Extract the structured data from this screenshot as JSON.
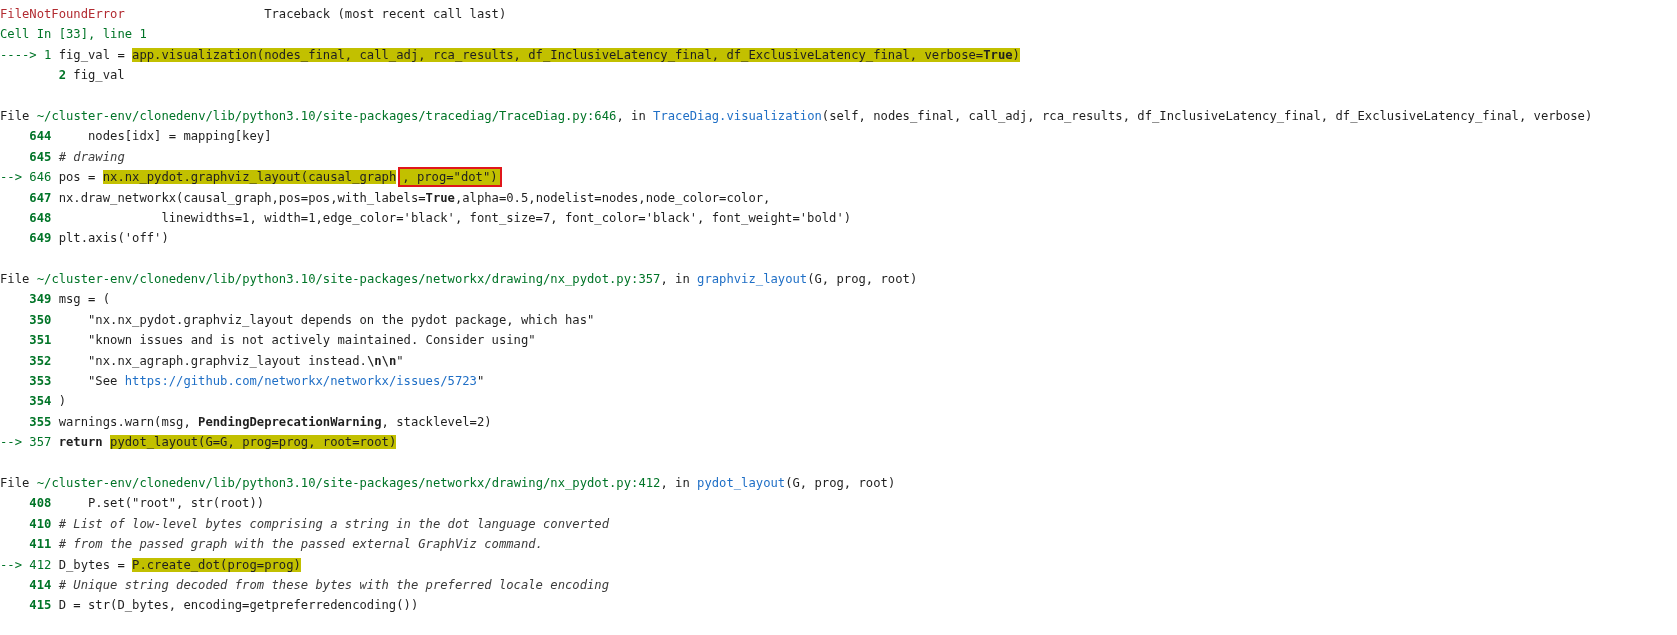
{
  "error": {
    "name": "FileNotFoundError",
    "title": "Traceback (most recent call last)"
  },
  "frames": [
    {
      "kind": "cell",
      "location": "Cell In [33], line 1",
      "marker": "---->",
      "lines": [
        {
          "number": "1",
          "current": true,
          "parts": [
            {
              "kind": "code",
              "text": "fig_val = "
            },
            {
              "kind": "highlight",
              "text": "app.visualization(nodes_final, call_adj, rca_results, df_InclusiveLatency_final, df_ExclusiveLatency_final, verbose=**True**)"
            }
          ]
        },
        {
          "number": "2",
          "current": false,
          "parts": [
            {
              "kind": "code",
              "text": "fig_val"
            }
          ]
        }
      ]
    },
    {
      "kind": "file",
      "file_label": "File",
      "in_label": ", in",
      "location": "~/cluster-env/clonedenv/lib/python3.10/site-packages/tracediag/TraceDiag.py:646",
      "function": "TraceDiag.visualization",
      "signature": "(self, nodes_final, call_adj, rca_results, df_InclusiveLatency_final, df_ExclusiveLatency_final, verbose)",
      "marker": "-->",
      "lines": [
        {
          "number": "644",
          "current": false,
          "parts": [
            {
              "kind": "code",
              "text": "    nodes[idx] = mapping[key]"
            }
          ]
        },
        {
          "number": "645",
          "current": false,
          "parts": [
            {
              "kind": "comment",
              "text": "# drawing"
            }
          ]
        },
        {
          "number": "646",
          "current": true,
          "parts": [
            {
              "kind": "code",
              "text": "pos = "
            },
            {
              "kind": "highlight",
              "text": "nx.nx_pydot.graphviz_layout(causal_graph"
            },
            {
              "kind": "highlight",
              "boxed": true,
              "text": ", prog=\"dot\")"
            }
          ]
        },
        {
          "number": "647",
          "current": false,
          "parts": [
            {
              "kind": "code",
              "text": "nx.draw_networkx(causal_graph,pos=pos,with_labels=**True**,alpha=0.5,nodelist=nodes,node_color=color,"
            }
          ]
        },
        {
          "number": "648",
          "current": false,
          "parts": [
            {
              "kind": "code",
              "text": "              linewidths=1, width=1,edge_color='black', font_size=7, font_color='black', font_weight='bold')"
            }
          ]
        },
        {
          "number": "649",
          "current": false,
          "parts": [
            {
              "kind": "code",
              "text": "plt.axis('off')"
            }
          ]
        }
      ]
    },
    {
      "kind": "file",
      "file_label": "File",
      "in_label": ", in",
      "location": "~/cluster-env/clonedenv/lib/python3.10/site-packages/networkx/drawing/nx_pydot.py:357",
      "function": "graphviz_layout",
      "signature": "(G, prog, root)",
      "marker": "-->",
      "lines": [
        {
          "number": "349",
          "current": false,
          "parts": [
            {
              "kind": "code",
              "text": "msg = ("
            }
          ]
        },
        {
          "number": "350",
          "current": false,
          "parts": [
            {
              "kind": "code",
              "text": "    \"nx.nx_pydot.graphviz_layout depends on the pydot package, which has\""
            }
          ]
        },
        {
          "number": "351",
          "current": false,
          "parts": [
            {
              "kind": "code",
              "text": "    \"known issues and is not actively maintained. Consider using\""
            }
          ]
        },
        {
          "number": "352",
          "current": false,
          "parts": [
            {
              "kind": "code",
              "text": "    \"nx.nx_agraph.graphviz_layout instead.**\\n\\n**\""
            }
          ]
        },
        {
          "number": "353",
          "current": false,
          "parts": [
            {
              "kind": "code",
              "text": "    \"See "
            },
            {
              "kind": "link",
              "text": "https://github.com/networkx/networkx/issues/5723"
            },
            {
              "kind": "code",
              "text": "\""
            }
          ]
        },
        {
          "number": "354",
          "current": false,
          "parts": [
            {
              "kind": "code",
              "text": ")"
            }
          ]
        },
        {
          "number": "355",
          "current": false,
          "parts": [
            {
              "kind": "code",
              "text": "warnings.warn(msg, **PendingDeprecationWarning**, stacklevel=2)"
            }
          ]
        },
        {
          "number": "357",
          "current": true,
          "parts": [
            {
              "kind": "code",
              "text": "**return** "
            },
            {
              "kind": "highlight",
              "text": "pydot_layout(G=G, prog=prog, root=root)"
            }
          ]
        }
      ]
    },
    {
      "kind": "file",
      "file_label": "File",
      "in_label": ", in",
      "location": "~/cluster-env/clonedenv/lib/python3.10/site-packages/networkx/drawing/nx_pydot.py:412",
      "function": "pydot_layout",
      "signature": "(G, prog, root)",
      "marker": "-->",
      "lines": [
        {
          "number": "408",
          "current": false,
          "parts": [
            {
              "kind": "code",
              "text": "    P.set(\"root\", str(root))"
            }
          ]
        },
        {
          "number": "410",
          "current": false,
          "parts": [
            {
              "kind": "comment",
              "text": "# List of low-level bytes comprising a string in the dot language converted"
            }
          ]
        },
        {
          "number": "411",
          "current": false,
          "parts": [
            {
              "kind": "comment",
              "text": "# from the passed graph with the passed external GraphViz command."
            }
          ]
        },
        {
          "number": "412",
          "current": true,
          "parts": [
            {
              "kind": "code",
              "text": "D_bytes = "
            },
            {
              "kind": "highlight",
              "text": "P.create_dot(prog=prog)"
            }
          ]
        },
        {
          "number": "414",
          "current": false,
          "parts": [
            {
              "kind": "comment",
              "text": "# Unique string decoded from these bytes with the preferred locale encoding"
            }
          ]
        },
        {
          "number": "415",
          "current": false,
          "parts": [
            {
              "kind": "code",
              "text": "D = str(D_bytes, encoding=getpreferredencoding())"
            }
          ]
        }
      ]
    }
  ]
}
